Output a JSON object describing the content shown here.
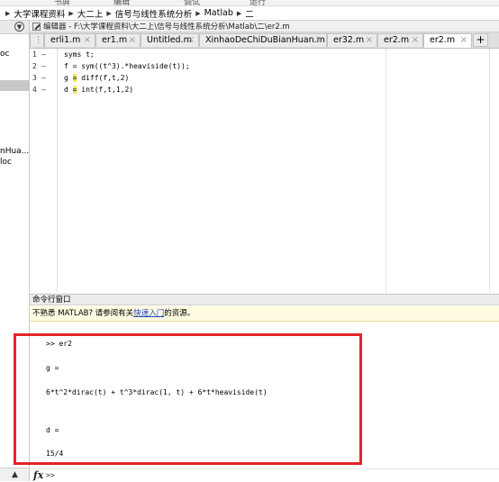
{
  "breadcrumb": [
    "大学课程资料",
    "大二上",
    "信号与线性系统分析",
    "Matlab",
    "二"
  ],
  "toolbar_partial": [
    "书屏",
    "编辑",
    "调试",
    "运行"
  ],
  "left_panel": {
    "items": [
      "oc",
      "nHua...",
      "loc"
    ]
  },
  "editor": {
    "title": "编辑器 - F:\\大学课程资料\\大二上\\信号与线性系统分析\\Matlab\\二\\er2.m",
    "tabs": [
      {
        "label": "erli1.m",
        "close": "×"
      },
      {
        "label": "er1.m",
        "close": "×"
      },
      {
        "label": "Untitled.m",
        "close": "×"
      },
      {
        "label": "XinhaoDeChiDuBianHuan.m",
        "close": "×"
      },
      {
        "label": "er32.m",
        "close": "×"
      },
      {
        "label": "er2.m",
        "close": "×"
      },
      {
        "label": "er2.m",
        "close": "×"
      }
    ],
    "add_tab": "+",
    "code": [
      {
        "num": "1",
        "text": "syms t;"
      },
      {
        "num": "2",
        "text": "f = sym((t^3).*heaviside(t));"
      },
      {
        "num": "3",
        "pre": "g ",
        "eq": "=",
        "post": " diff(f,t,2)"
      },
      {
        "num": "4",
        "pre": "d ",
        "eq": "=",
        "post": " int(f,t,1,2)"
      }
    ]
  },
  "command_window": {
    "title": "命令行窗口",
    "banner_pre": "不熟悉 MATLAB? 请参阅有关",
    "banner_link": "快速入门",
    "banner_post": "的资源。",
    "output": [
      ">> er2",
      "g =",
      "6*t^2*dirac(t) + t^3*dirac(1, t) + 6*t*heaviside(t)",
      "d =",
      "15/4"
    ],
    "fx": "fx",
    "prompt": ">>"
  },
  "colors": {
    "highlight": "#f3e85c",
    "annotation_box": "#e3242b",
    "link": "#1a44c2"
  }
}
